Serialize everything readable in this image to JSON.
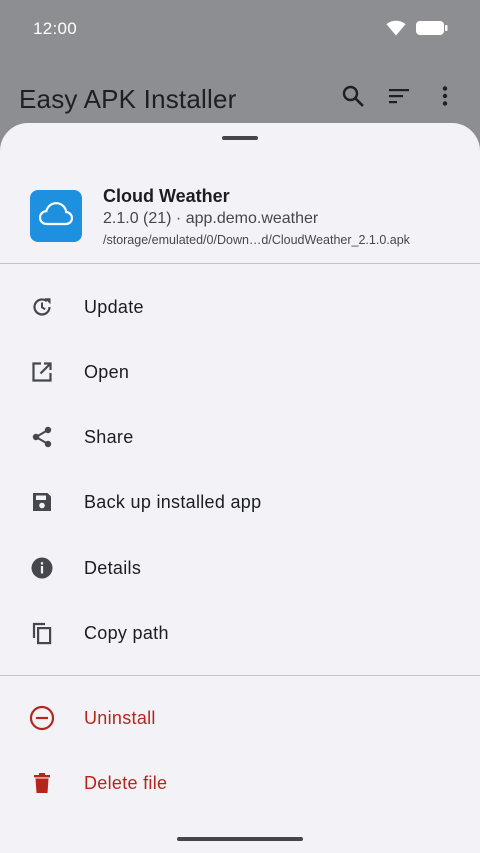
{
  "status_bar": {
    "time": "12:00",
    "icons": [
      "wifi-icon",
      "battery-icon"
    ]
  },
  "app_bar": {
    "title": "Easy APK Installer",
    "actions": [
      "search-icon",
      "sort-icon",
      "more-vert-icon"
    ]
  },
  "sheet": {
    "app": {
      "name": "Cloud Weather",
      "version_line": "2.1.0 (21) · app.demo.weather",
      "path": "/storage/emulated/0/Down…d/CloudWeather_2.1.0.apk",
      "icon": "cloud-icon",
      "icon_color": "#1e90e0"
    },
    "actions": [
      {
        "label": "Update",
        "icon": "update-icon"
      },
      {
        "label": "Open",
        "icon": "open-external-icon"
      },
      {
        "label": "Share",
        "icon": "share-icon"
      },
      {
        "label": "Back up installed app",
        "icon": "save-icon"
      },
      {
        "label": "Details",
        "icon": "info-icon"
      },
      {
        "label": "Copy path",
        "icon": "copy-icon"
      }
    ],
    "danger_actions": [
      {
        "label": "Uninstall",
        "icon": "uninstall-icon"
      },
      {
        "label": "Delete file",
        "icon": "delete-icon"
      }
    ],
    "danger_color": "#b3261e"
  }
}
